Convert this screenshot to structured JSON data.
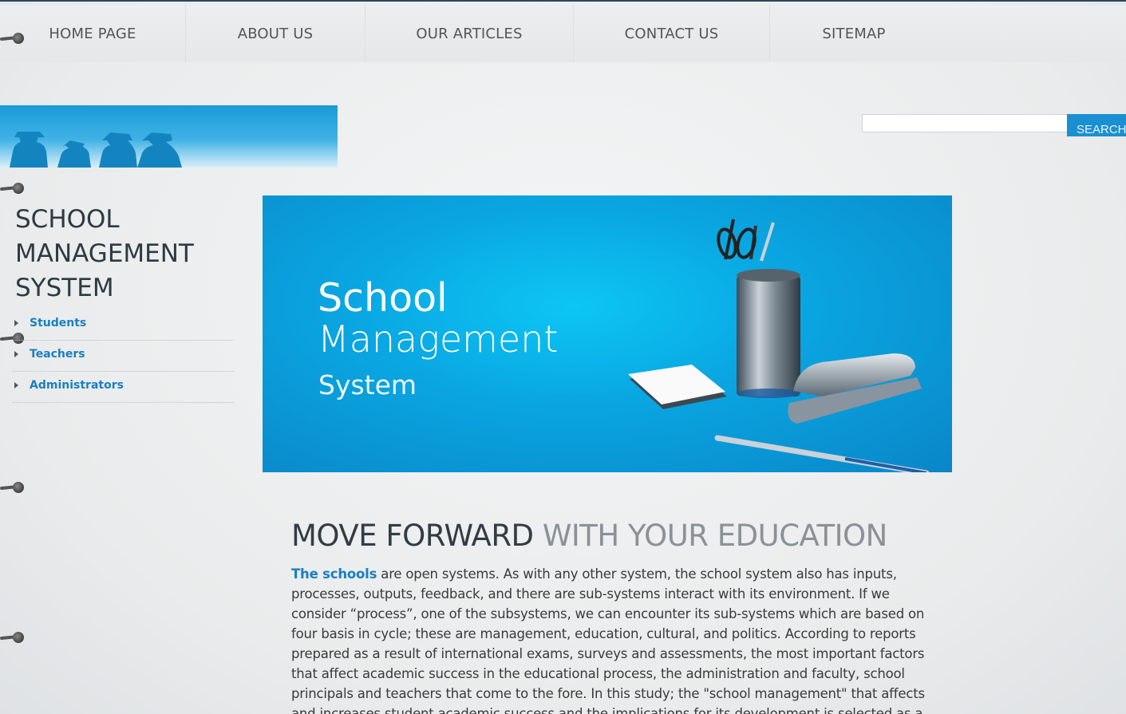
{
  "nav": {
    "items": [
      {
        "label": "HOME PAGE"
      },
      {
        "label": "ABOUT US"
      },
      {
        "label": "OUR ARTICLES"
      },
      {
        "label": "CONTACT US"
      },
      {
        "label": "SITEMAP"
      }
    ]
  },
  "search": {
    "placeholder": "",
    "value": "",
    "button_label": "SEARCH"
  },
  "sidebar": {
    "title": "SCHOOL MANAGEMENT SYSTEM",
    "items": [
      {
        "label": "Students"
      },
      {
        "label": "Teachers"
      },
      {
        "label": "Administrators"
      }
    ]
  },
  "hero": {
    "line1": "School",
    "line2": "Management",
    "line3": "System"
  },
  "content": {
    "heading_strong": "MOVE FORWARD",
    "heading_light": "WITH YOUR EDUCATION",
    "lead_link": "The schools",
    "body": " are open systems. As with any other system, the school system also has inputs, processes, outputs, feedback, and there are sub-systems interact with its environment. If we consider “process”, one of the subsystems, we can encounter its sub-systems which are based on four basis in cycle; these are management, education, cultural, and politics. According to reports prepared as a result of international exams, surveys and assessments, the most important factors that affect academic success in the educational process, the administration and faculty, school principals and teachers that come to the fore. In this study; the \"school management\" that affects and increases student academic success and the implications for its development is selected as a main problem and tried to be clarified the"
  },
  "colors": {
    "accent": "#1a7fc0",
    "hero_blue": "#0aa7e2",
    "nav_text": "#555555"
  }
}
